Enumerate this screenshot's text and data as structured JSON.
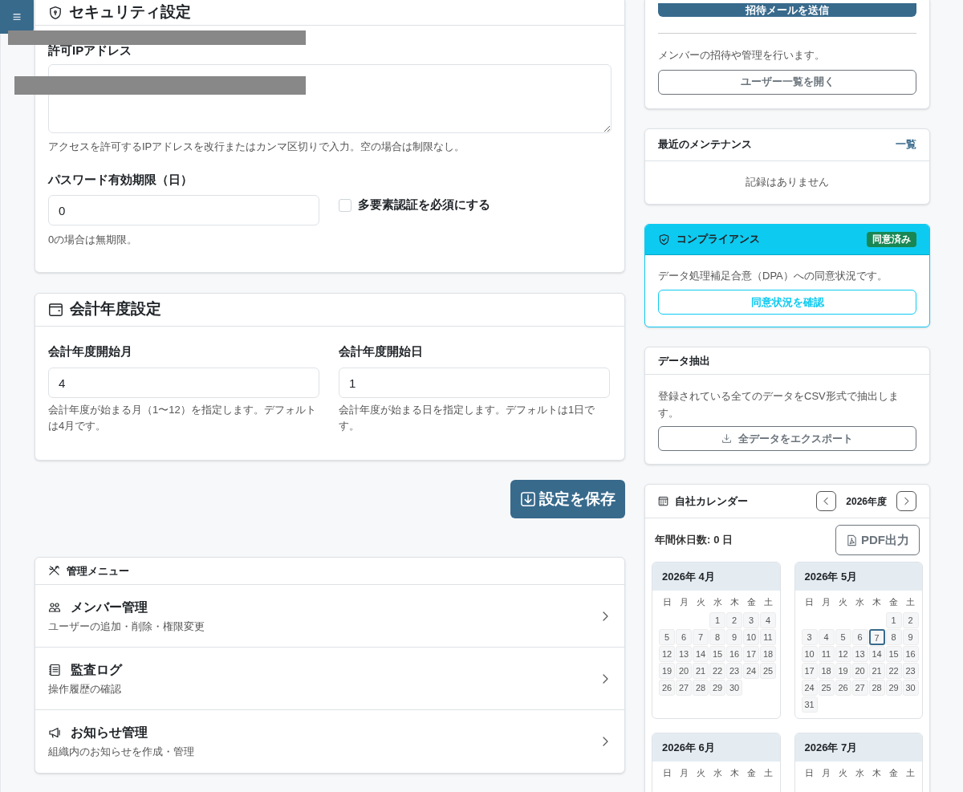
{
  "menu_button": {
    "label": "≡"
  },
  "security": {
    "title": "セキュリティ設定",
    "ip_label": "許可IPアドレス",
    "ip_help": "アクセスを許可するIPアドレスを改行またはカンマ区切りで入力。空の場合は制限なし。",
    "password_label": "パスワード有効期限（日）",
    "password_value": "0",
    "password_help": "0の場合は無期限。",
    "mfa": {
      "label": "多要素認証を必須にする",
      "checked": false
    }
  },
  "fiscal": {
    "title": "会計年度設定",
    "fields": [
      {
        "label": "会計年度開始月",
        "value": "4",
        "help": "会計年度が始まる月（1〜12）を指定します。デフォルトは4月です。"
      },
      {
        "label": "会計年度開始日",
        "value": "1",
        "help": "会計年度が始まる日を指定します。デフォルトは1日です。"
      }
    ]
  },
  "save_button": "設定を保存",
  "admin_menu": {
    "title": "管理メニュー",
    "items": [
      {
        "kind": "members",
        "title": "メンバー管理",
        "description": "ユーザーの追加・削除・権限変更"
      },
      {
        "kind": "audit",
        "title": "監査ログ",
        "description": "操作履歴の確認"
      },
      {
        "kind": "notices",
        "title": "お知らせ管理",
        "description": "組織内のお知らせを作成・管理"
      }
    ]
  },
  "invite": {
    "send_button": "招待メールを送信",
    "description": "メンバーの招待や管理を行います。",
    "open_button": "ユーザー一覧を開く"
  },
  "maintenance": {
    "title": "最近のメンテナンス",
    "link": "一覧",
    "empty": "記録はありません"
  },
  "compliance": {
    "title": "コンプライアンス",
    "badge": "同意済み",
    "description": "データ処理補足合意（DPA）への同意状況です。",
    "button": "同意状況を確認"
  },
  "export": {
    "title": "データ抽出",
    "description": "登録されている全てのデータをCSV形式で抽出します。",
    "button": "全データをエクスポート"
  },
  "calendar": {
    "title": "自社カレンダー",
    "year": "2026年度",
    "holidays_label": "年間休日数:",
    "holidays_value": "0 日",
    "pdf_button": "PDF出力",
    "months": [
      {
        "title": "2026年 4月",
        "weekdays": [
          "日",
          "月",
          "火",
          "水",
          "木",
          "金",
          "土"
        ],
        "weeks": [
          [
            {
              "day": "1",
              "today": false
            },
            {
              "day": "2",
              "today": false
            },
            {
              "day": "3",
              "today": false
            },
            {
              "day": "4",
              "today": false
            }
          ],
          [
            {
              "day": "5",
              "today": false
            },
            {
              "day": "6",
              "today": false
            },
            {
              "day": "7",
              "today": false
            },
            {
              "day": "8",
              "today": false
            },
            {
              "day": "9",
              "today": false
            },
            {
              "day": "10",
              "today": false
            },
            {
              "day": "11",
              "today": false
            }
          ],
          [
            {
              "day": "12",
              "today": false
            },
            {
              "day": "13",
              "today": false
            },
            {
              "day": "14",
              "today": false
            },
            {
              "day": "15",
              "today": false
            },
            {
              "day": "16",
              "today": false
            },
            {
              "day": "17",
              "today": false
            },
            {
              "day": "18",
              "today": false
            }
          ],
          [
            {
              "day": "19",
              "today": false
            },
            {
              "day": "20",
              "today": false
            },
            {
              "day": "21",
              "today": false
            },
            {
              "day": "22",
              "today": false
            },
            {
              "day": "23",
              "today": false
            },
            {
              "day": "24",
              "today": false
            },
            {
              "day": "25",
              "today": false
            }
          ],
          [
            {
              "day": "26",
              "today": false
            },
            {
              "day": "27",
              "today": false
            },
            {
              "day": "28",
              "today": false
            },
            {
              "day": "29",
              "today": false
            },
            {
              "day": "30",
              "today": false
            }
          ]
        ]
      },
      {
        "title": "2026年 5月",
        "weekdays": [
          "日",
          "月",
          "火",
          "水",
          "木",
          "金",
          "土"
        ],
        "weeks": [
          [
            {
              "day": "1",
              "today": false
            },
            {
              "day": "2",
              "today": false
            }
          ],
          [
            {
              "day": "3",
              "today": false
            },
            {
              "day": "4",
              "today": false
            },
            {
              "day": "5",
              "today": false
            },
            {
              "day": "6",
              "today": false
            },
            {
              "day": "7",
              "today": true
            },
            {
              "day": "8",
              "today": false
            },
            {
              "day": "9",
              "today": false
            }
          ],
          [
            {
              "day": "10",
              "today": false
            },
            {
              "day": "11",
              "today": false
            },
            {
              "day": "12",
              "today": false
            },
            {
              "day": "13",
              "today": false
            },
            {
              "day": "14",
              "today": false
            },
            {
              "day": "15",
              "today": false
            },
            {
              "day": "16",
              "today": false
            }
          ],
          [
            {
              "day": "17",
              "today": false
            },
            {
              "day": "18",
              "today": false
            },
            {
              "day": "19",
              "today": false
            },
            {
              "day": "20",
              "today": false
            },
            {
              "day": "21",
              "today": false
            },
            {
              "day": "22",
              "today": false
            },
            {
              "day": "23",
              "today": false
            }
          ],
          [
            {
              "day": "24",
              "today": false
            },
            {
              "day": "25",
              "today": false
            },
            {
              "day": "26",
              "today": false
            },
            {
              "day": "27",
              "today": false
            },
            {
              "day": "28",
              "today": false
            },
            {
              "day": "29",
              "today": false
            },
            {
              "day": "30",
              "today": false
            }
          ],
          [
            {
              "day": "31",
              "today": false
            }
          ]
        ]
      },
      {
        "title": "2026年 6月",
        "weekdays": [
          "日",
          "月",
          "火",
          "水",
          "木",
          "金",
          "土"
        ]
      },
      {
        "title": "2026年 7月",
        "weekdays": [
          "日",
          "月",
          "火",
          "水",
          "木",
          "金",
          "土"
        ]
      }
    ]
  }
}
